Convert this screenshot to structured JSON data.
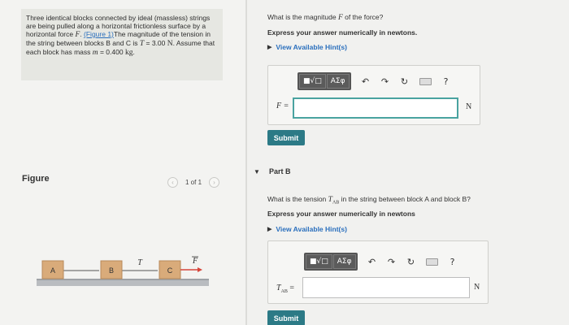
{
  "problem": {
    "text_1": "Three identical blocks connected by ideal (massless) strings are being pulled along a horizontal frictionless surface by a horizontal force ",
    "force_symbol": "F",
    "text_2": ". ",
    "figure_link": "(Figure 1)",
    "text_3": "The magnitude of the tension in the string between blocks B and C is ",
    "tension_symbol": "T",
    "text_4": " = 3.00 ",
    "unit_n": "N",
    "text_5": ". Assume that each block has mass ",
    "mass_symbol": "m",
    "text_6": " = 0.400 ",
    "unit_kg": "kg",
    "text_7": "."
  },
  "figure": {
    "label": "Figure",
    "pager_text": "1 of 1",
    "prev_icon": "chevron-left-icon",
    "next_icon": "chevron-right-icon",
    "block_a": "A",
    "block_b": "B",
    "block_c": "C",
    "tension_label": "T",
    "force_label": "F",
    "colors": {
      "block": "#d9ab7a",
      "surface": "#b9bcc0",
      "force_arrow": "#d6453a"
    }
  },
  "part_a": {
    "question_pre": "What is the magnitude ",
    "question_sym": "F",
    "question_post": " of the force?",
    "instruction": "Express your answer numerically in newtons.",
    "hint": "View Available Hint(s)",
    "toolbar": {
      "btn_template": "■√□",
      "btn_greek": "AΣφ",
      "undo_icon": "undo-icon",
      "redo_icon": "redo-icon",
      "reset_icon": "reset-icon",
      "keyboard_icon": "keyboard-icon",
      "help_label": "?"
    },
    "var_label": "F =",
    "input_value": "",
    "unit": "N",
    "submit": "Submit"
  },
  "part_b": {
    "toggle": "▼",
    "title": "Part B",
    "question_pre": "What is the tension ",
    "question_sym": "T",
    "question_sub": "AB",
    "question_post": " in the string between block A and block B?",
    "instruction": "Express your answer numerically in newtons",
    "hint": "View Available Hint(s)",
    "toolbar": {
      "btn_template": "■√□",
      "btn_greek": "AΣφ",
      "help_label": "?"
    },
    "var_label": "T",
    "var_sub": "AB",
    "var_eq": "=",
    "input_value": "",
    "unit": "N",
    "submit": "Submit"
  }
}
